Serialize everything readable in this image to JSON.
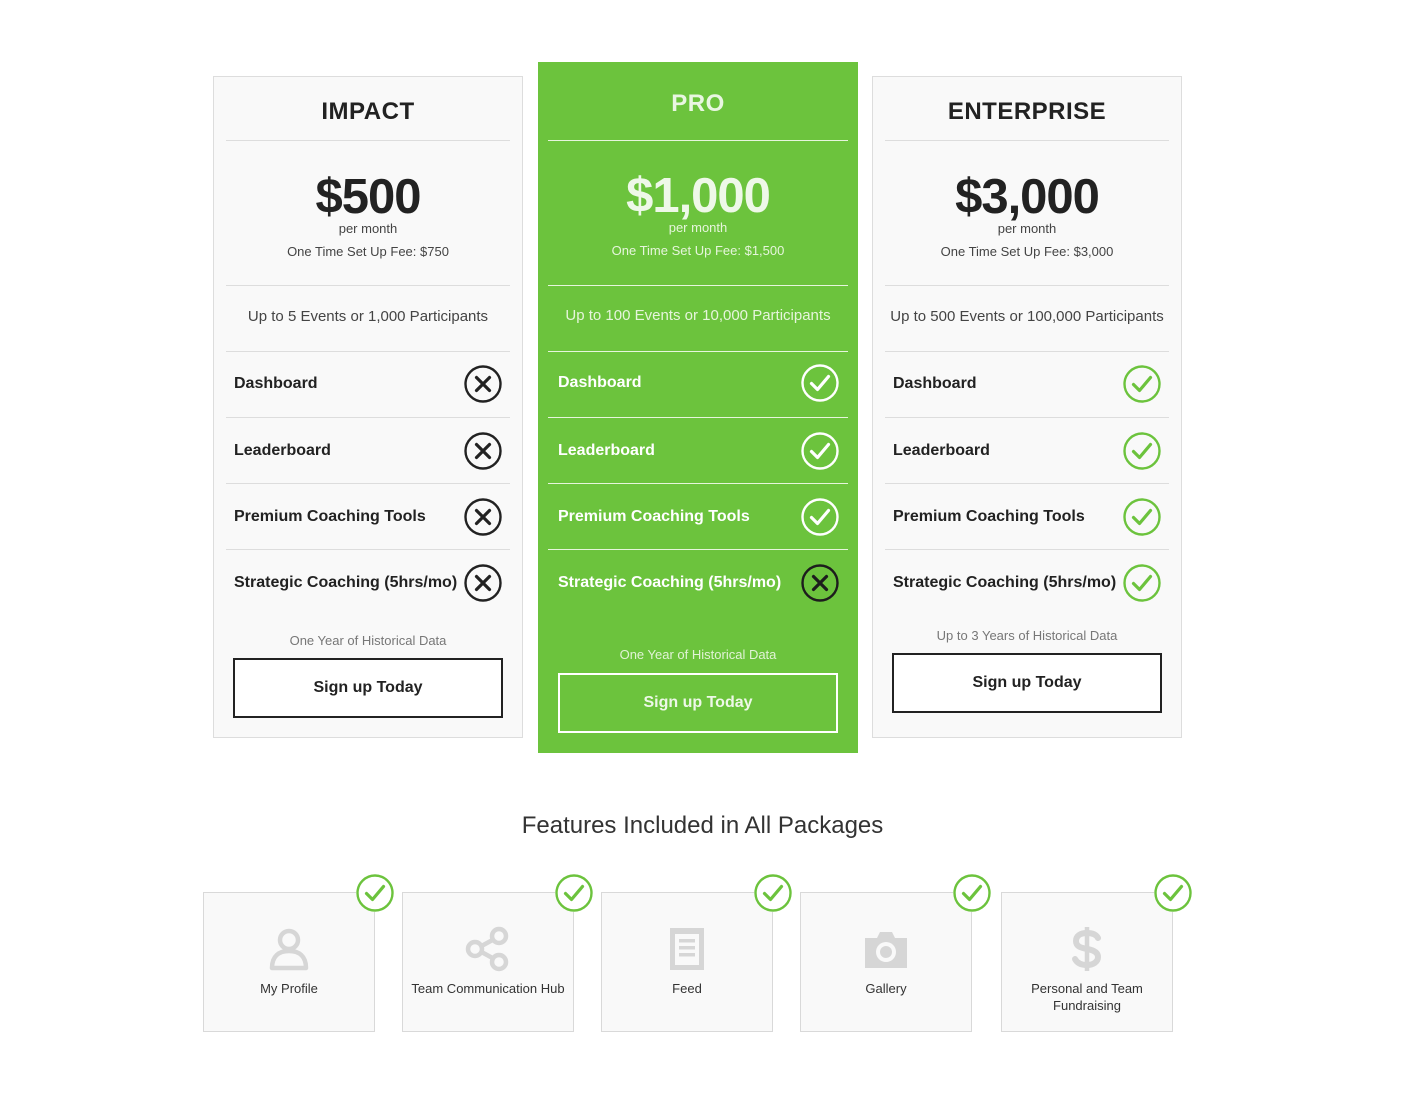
{
  "plans": [
    {
      "id": "impact",
      "name": "IMPACT",
      "price": "$500",
      "period": "per month",
      "setup_fee": "One Time Set Up Fee: $750",
      "capacity": "Up to 5 Events or 1,000 Participants",
      "features": [
        {
          "label": "Dashboard",
          "included": false
        },
        {
          "label": "Leaderboard",
          "included": false
        },
        {
          "label": "Premium Coaching Tools",
          "included": false
        },
        {
          "label": "Strategic Coaching (5hrs/mo)",
          "included": false
        }
      ],
      "history": "One Year of Historical Data",
      "cta": "Sign up Today"
    },
    {
      "id": "pro",
      "name": "PRO",
      "price": "$1,000",
      "period": "per month",
      "setup_fee": "One Time Set Up Fee: $1,500",
      "capacity": "Up to 100 Events or 10,000 Participants",
      "features": [
        {
          "label": "Dashboard",
          "included": true
        },
        {
          "label": "Leaderboard",
          "included": true
        },
        {
          "label": "Premium Coaching Tools",
          "included": true
        },
        {
          "label": "Strategic Coaching (5hrs/mo)",
          "included": false
        }
      ],
      "history": "One Year of Historical Data",
      "cta": "Sign up Today"
    },
    {
      "id": "enterprise",
      "name": "ENTERPRISE",
      "price": "$3,000",
      "period": "per month",
      "setup_fee": "One Time Set Up Fee: $3,000",
      "capacity": "Up to 500 Events or 100,000 Participants",
      "features": [
        {
          "label": "Dashboard",
          "included": true
        },
        {
          "label": "Leaderboard",
          "included": true
        },
        {
          "label": "Premium Coaching Tools",
          "included": true
        },
        {
          "label": "Strategic Coaching (5hrs/mo)",
          "included": true
        }
      ],
      "history": "Up to 3 Years of Historical Data",
      "cta": "Sign up Today"
    }
  ],
  "included": {
    "heading": "Features Included in All Packages",
    "items": [
      {
        "label": "My Profile",
        "icon": "user-icon"
      },
      {
        "label": "Team Communication Hub",
        "icon": "share-icon"
      },
      {
        "label": "Feed",
        "icon": "document-icon"
      },
      {
        "label": "Gallery",
        "icon": "camera-icon"
      },
      {
        "label": "Personal and Team Fundraising",
        "icon": "dollar-icon"
      }
    ]
  },
  "colors": {
    "accent_green": "#6cc33d",
    "check_green": "#6cc33d",
    "text_dark": "#222222",
    "card_bg": "#f9f9f9",
    "tile_icon": "#d6d6d6"
  }
}
